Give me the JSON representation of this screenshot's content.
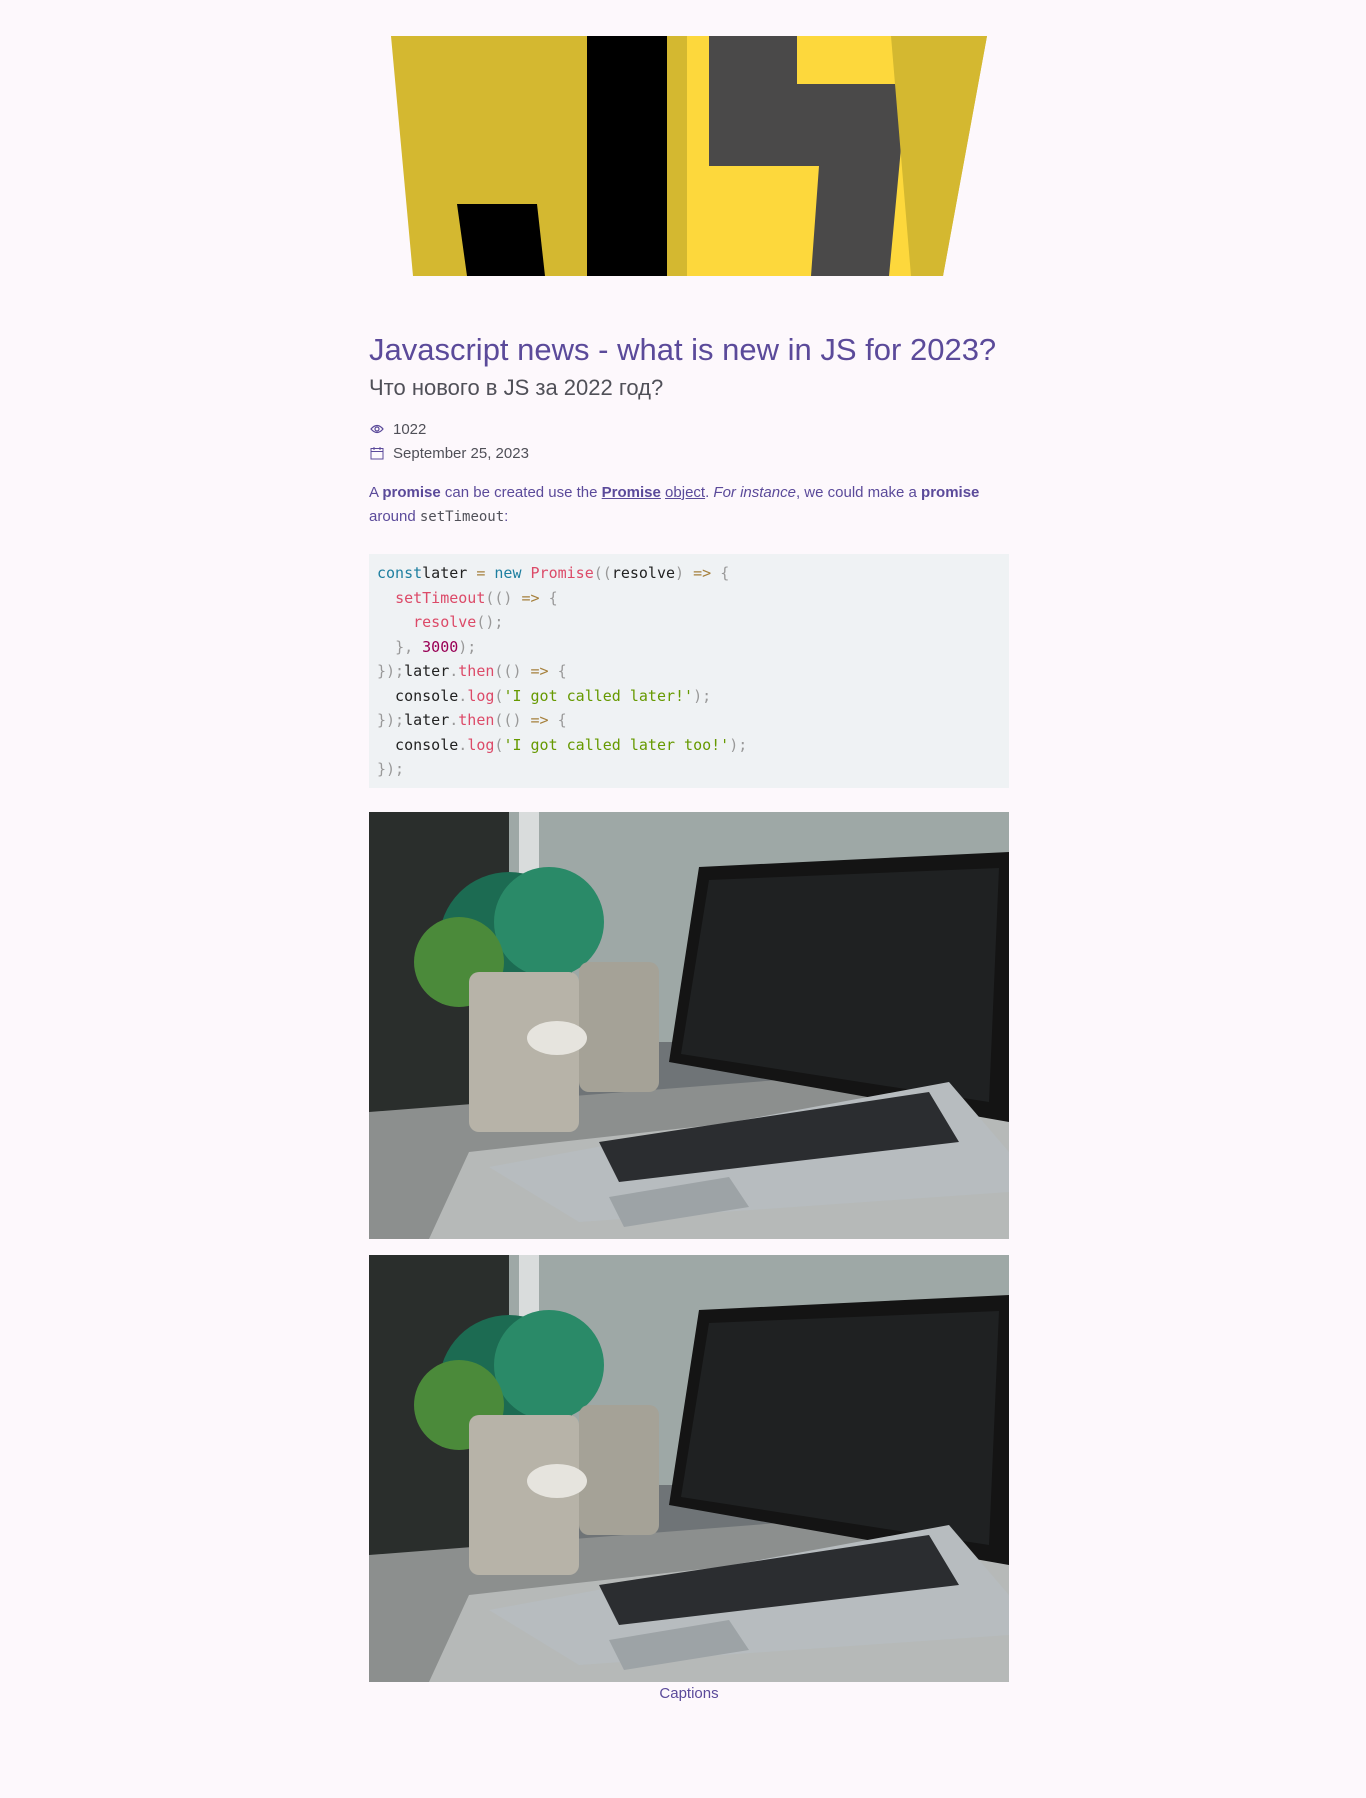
{
  "hero": {
    "logo_icon": "js-logo-icon"
  },
  "article": {
    "title": "Javascript news - what is new in JS for 2023?",
    "subtitle": "Что нового в JS за 2022 год?",
    "views": "1022",
    "date": "September 25, 2023",
    "intro": {
      "t1": "A ",
      "b1": "promise",
      "t2": " can be created use the ",
      "link_promise": "Promise",
      "t3": " ",
      "link_object": "object",
      "t4": ". ",
      "i1": "For instance",
      "t5": ", we could make a ",
      "b2": "promise",
      "t6": " around ",
      "code1": "setTimeout",
      "t7": ":"
    },
    "code_lines": [
      [
        [
          "kw",
          "const"
        ],
        [
          "",
          "later "
        ],
        [
          "op",
          "= "
        ],
        [
          "kw",
          "new "
        ],
        [
          "fn",
          "Promise"
        ],
        [
          "pn",
          "(("
        ],
        [
          "",
          "resolve"
        ],
        [
          "pn",
          ") "
        ],
        [
          "op",
          "=> "
        ],
        [
          "pn",
          "{"
        ]
      ],
      [
        [
          "",
          "  "
        ],
        [
          "fn",
          "setTimeout"
        ],
        [
          "pn",
          "(() "
        ],
        [
          "op",
          "=> "
        ],
        [
          "pn",
          "{"
        ]
      ],
      [
        [
          "",
          "    "
        ],
        [
          "fn",
          "resolve"
        ],
        [
          "pn",
          "();"
        ]
      ],
      [
        [
          "",
          "  "
        ],
        [
          "pn",
          "}, "
        ],
        [
          "nm",
          "3000"
        ],
        [
          "pn",
          ");"
        ]
      ],
      [
        [
          "pn",
          "});"
        ],
        [
          "",
          "later"
        ],
        [
          "pn",
          "."
        ],
        [
          "fn",
          "then"
        ],
        [
          "pn",
          "(() "
        ],
        [
          "op",
          "=> "
        ],
        [
          "pn",
          "{"
        ]
      ],
      [
        [
          "",
          "  console"
        ],
        [
          "pn",
          "."
        ],
        [
          "fn",
          "log"
        ],
        [
          "pn",
          "("
        ],
        [
          "st",
          "'I got called later!'"
        ],
        [
          "pn",
          ");"
        ]
      ],
      [
        [
          "pn",
          "});"
        ],
        [
          "",
          "later"
        ],
        [
          "pn",
          "."
        ],
        [
          "fn",
          "then"
        ],
        [
          "pn",
          "(() "
        ],
        [
          "op",
          "=> "
        ],
        [
          "pn",
          "{"
        ]
      ],
      [
        [
          "",
          "  console"
        ],
        [
          "pn",
          "."
        ],
        [
          "fn",
          "log"
        ],
        [
          "pn",
          "("
        ],
        [
          "st",
          "'I got called later too!'"
        ],
        [
          "pn",
          ");"
        ]
      ],
      [
        [
          "pn",
          "});"
        ]
      ]
    ],
    "caption": "Captions"
  },
  "icons": {
    "views": "eye-icon",
    "date": "calendar-icon"
  },
  "colors": {
    "accent": "#5b4a9a",
    "js_yellow": "#f7d73e",
    "background": "#fdf8fc"
  }
}
